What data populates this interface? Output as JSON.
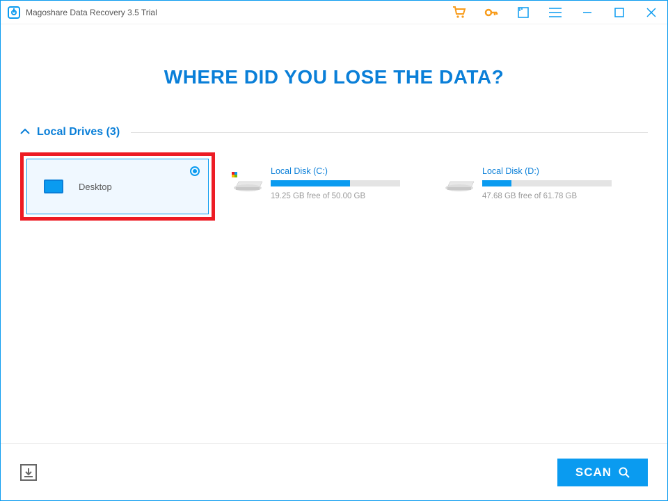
{
  "app": {
    "title": "Magoshare Data Recovery 3.5 Trial"
  },
  "headline": "WHERE DID YOU LOSE THE DATA?",
  "section": {
    "title_full": "Local Drives (3)"
  },
  "drives": {
    "desktop": {
      "label": "Desktop"
    },
    "c": {
      "title": "Local Disk (C:)",
      "free": "19.25 GB free of 50.00 GB",
      "used_pct": 61.5
    },
    "d": {
      "title": "Local Disk (D:)",
      "free": "47.68 GB free of 61.78 GB",
      "used_pct": 22.8
    }
  },
  "footer": {
    "scan": "SCAN"
  }
}
